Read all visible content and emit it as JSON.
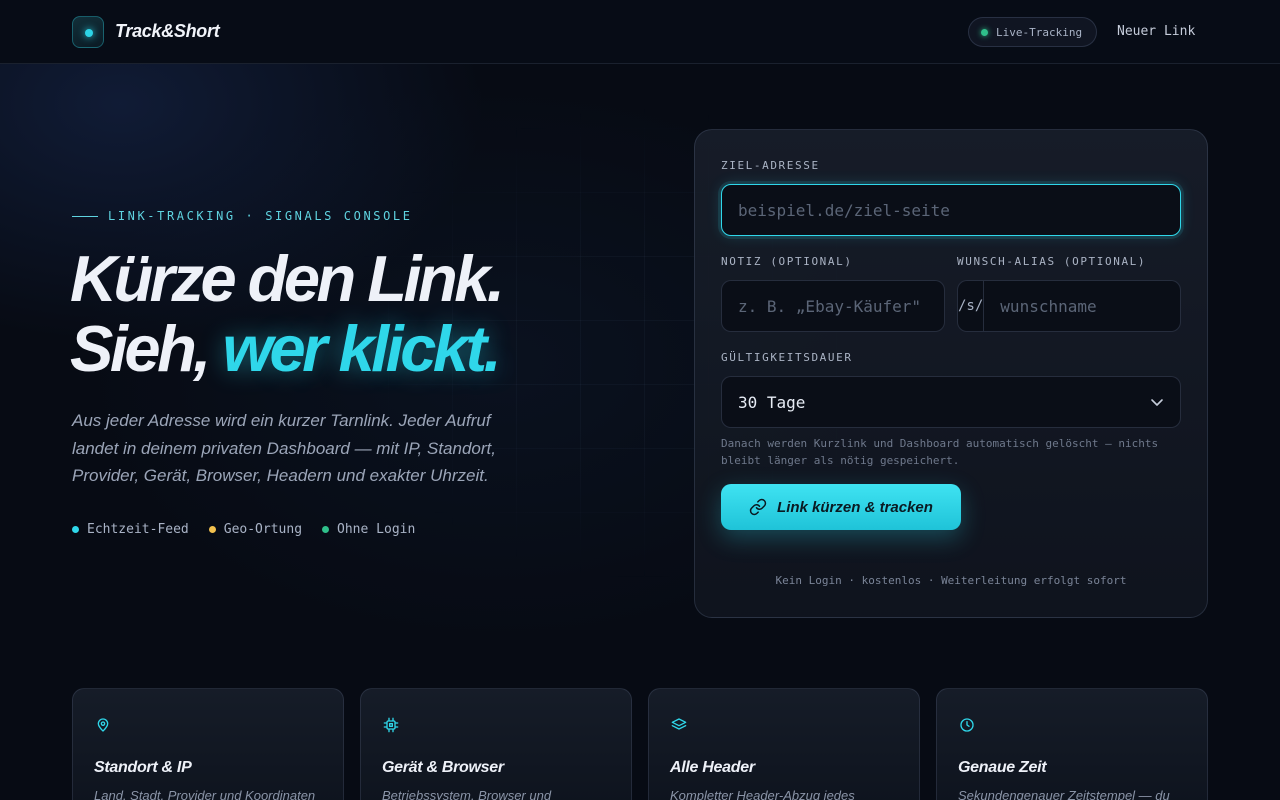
{
  "header": {
    "brand": "Track&Short",
    "live_label": "Live-Tracking",
    "new_link_label": "Neuer Link"
  },
  "hero": {
    "eyebrow": "LINK-TRACKING · SIGNALS CONSOLE",
    "headline_line1": "Kürze den Link.",
    "headline_line2_plain": "Sieh, ",
    "headline_line2_accent": "wer klickt.",
    "lead": "Aus jeder Adresse wird ein kurzer Tarnlink. Jeder Aufruf landet in deinem privaten Dashboard — mit IP, Standort, Provider, Gerät, Browser, Headern und exakter Uhrzeit.",
    "features": [
      {
        "label": "Echtzeit-Feed",
        "color": "#2fd7ea"
      },
      {
        "label": "Geo-Ortung",
        "color": "#f2c14e"
      },
      {
        "label": "Ohne Login",
        "color": "#2fbf8a"
      }
    ]
  },
  "form": {
    "target_label": "ZIEL-ADRESSE",
    "target_placeholder": "beispiel.de/ziel-seite",
    "note_label": "NOTIZ (OPTIONAL)",
    "note_placeholder": "z. B. „Ebay-Käufer\"",
    "alias_label": "WUNSCH-ALIAS (OPTIONAL)",
    "alias_prefix": "/s/",
    "alias_placeholder": "wunschname",
    "validity_label": "GÜLTIGKEITSDAUER",
    "validity_value": "30 Tage",
    "hint": "Danach werden Kurzlink und Dashboard automatisch gelöscht — nichts bleibt länger als nötig gespeichert.",
    "submit_label": "Link kürzen & tracken",
    "footnote": "Kein Login · kostenlos · Weiterleitung erfolgt sofort"
  },
  "feature_cards": [
    {
      "icon": "map-pin-icon",
      "title": "Standort & IP",
      "desc": "Land, Stadt, Provider und Koordinaten"
    },
    {
      "icon": "cpu-chip-icon",
      "title": "Gerät & Browser",
      "desc": "Betriebssystem, Browser und"
    },
    {
      "icon": "layers-icon",
      "title": "Alle Header",
      "desc": "Kompletter Header-Abzug jedes"
    },
    {
      "icon": "clock-icon",
      "title": "Genaue Zeit",
      "desc": "Sekundengenauer Zeitstempel — du"
    }
  ],
  "colors": {
    "accent": "#2fd7ea",
    "background": "#070b14"
  }
}
